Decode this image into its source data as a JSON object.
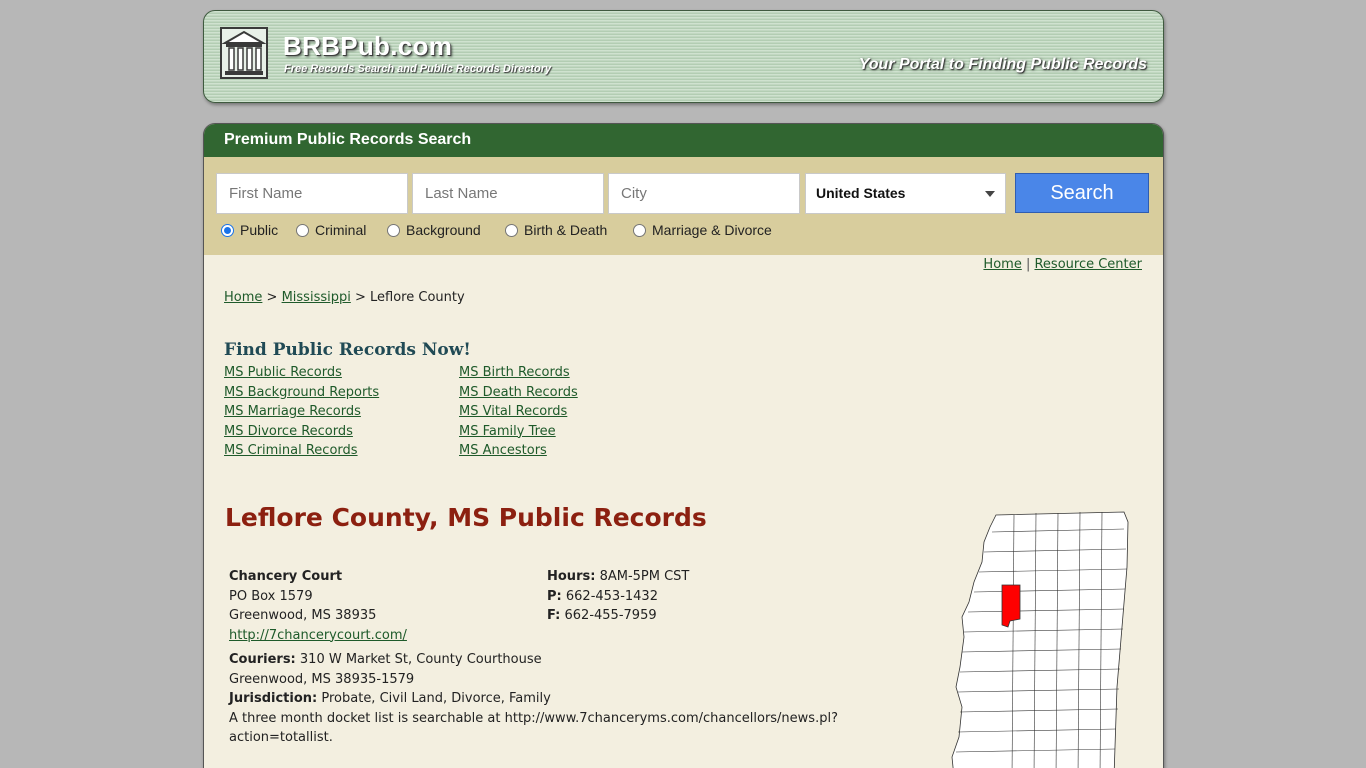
{
  "header": {
    "site_name": "BRBPub.com",
    "tagline": "Free Records Search and Public Records Directory",
    "slogan": "Your Portal to Finding Public Records"
  },
  "search": {
    "title": "Premium Public Records Search",
    "first_name_placeholder": "First Name",
    "last_name_placeholder": "Last Name",
    "city_placeholder": "City",
    "country_selected": "United States",
    "button_label": "Search",
    "record_types": [
      {
        "label": "Public",
        "checked": true
      },
      {
        "label": "Criminal",
        "checked": false
      },
      {
        "label": "Background",
        "checked": false
      },
      {
        "label": "Birth & Death",
        "checked": false
      },
      {
        "label": "Marriage & Divorce",
        "checked": false
      }
    ]
  },
  "top_links": {
    "home": "Home",
    "separator": "|",
    "resource_center": "Resource Center"
  },
  "breadcrumb": {
    "home": "Home",
    "sep1": ">",
    "state": "Mississippi",
    "sep2": ">",
    "current": "Leflore County"
  },
  "find_records": {
    "title": "Find Public Records Now!",
    "left_links": [
      "MS Public Records",
      "MS Background Reports",
      "MS Marriage Records",
      "MS Divorce Records",
      "MS Criminal Records"
    ],
    "right_links": [
      "MS Birth Records",
      "MS Death Records",
      "MS Vital Records",
      "MS Family Tree",
      "MS Ancestors"
    ]
  },
  "county": {
    "title": "Leflore County, MS Public Records",
    "court_name": "Chancery Court",
    "address1": "PO Box 1579",
    "address2": "Greenwood, MS 38935",
    "website": "http://7chancerycourt.com/",
    "hours_label": "Hours:",
    "hours_value": "8AM-5PM CST",
    "phone_label": "P:",
    "phone_value": "662-453-1432",
    "fax_label": "F:",
    "fax_value": "662-455-7959",
    "couriers_label": "Couriers:",
    "couriers_value": "310 W Market St, County Courthouse",
    "couriers_city": "Greenwood, MS 38935-1579",
    "jurisdiction_label": "Jurisdiction:",
    "jurisdiction_value": "Probate, Civil Land, Divorce, Family",
    "note": "A three month docket list is searchable at http://www.7chanceryms.com/chancellors/news.pl?action=totallist."
  },
  "colors": {
    "header_green": "#316631",
    "panel_tan": "#d8cd9d",
    "page_bg": "#f3efe0",
    "title_red": "#8c2010",
    "link_green": "#1e5a2a",
    "highlight_county": "#ff0000"
  }
}
